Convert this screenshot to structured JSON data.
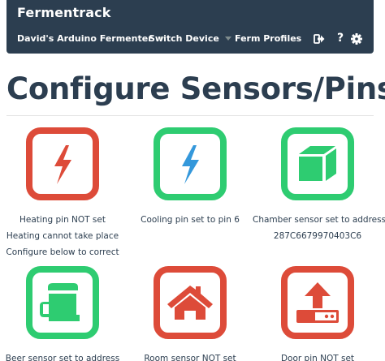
{
  "navbar": {
    "brand": "Fermentrack",
    "items": [
      {
        "label": "David's Arduino Fermenter",
        "has_caret": true
      },
      {
        "label": "Switch Device",
        "has_caret": true
      },
      {
        "label": "Ferm Profiles",
        "has_caret": false
      }
    ],
    "icons": [
      "sign-out-icon",
      "help-icon",
      "settings-icon"
    ],
    "help_glyph": "?"
  },
  "page": {
    "title": "Configure Sensors/Pins"
  },
  "colors": {
    "navbar_bg": "#2c3e50",
    "red": "#dd4b39",
    "green": "#2ecc71",
    "blue": "#3498db",
    "title": "#2c3e50"
  },
  "sensors": [
    {
      "icon": "bolt-icon",
      "status": "red",
      "lines": [
        "Heating pin NOT set",
        "Heating cannot take place",
        "Configure below to correct"
      ]
    },
    {
      "icon": "bolt-icon",
      "status": "green",
      "lines": [
        "Cooling pin set to pin 6"
      ]
    },
    {
      "icon": "cube-icon",
      "status": "green",
      "lines": [
        "Chamber sensor set to address",
        "287C6679970403C6"
      ]
    },
    {
      "icon": "beer-mug-icon",
      "status": "green",
      "lines": [
        "Beer sensor set to address"
      ]
    },
    {
      "icon": "home-icon",
      "status": "red",
      "lines": [
        "Room sensor NOT set"
      ]
    },
    {
      "icon": "upload-icon",
      "status": "red",
      "lines": [
        "Door pin NOT set"
      ]
    }
  ]
}
